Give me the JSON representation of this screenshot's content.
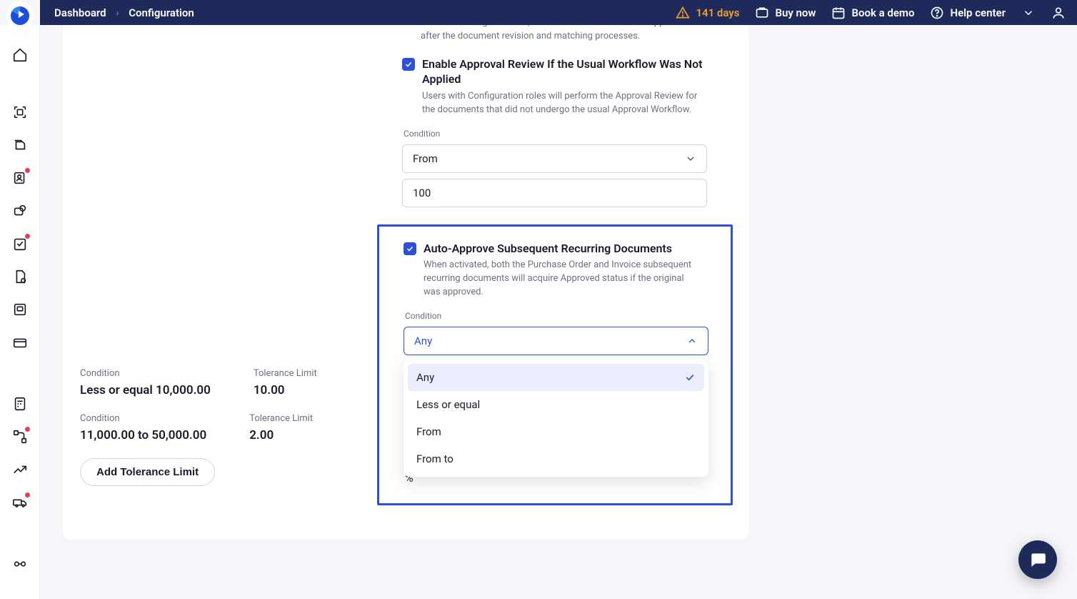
{
  "header": {
    "breadcrumb": [
      "Dashboard",
      "Configuration"
    ],
    "days_label": "141 days",
    "buy": "Buy now",
    "demo": "Book a demo",
    "help": "Help center"
  },
  "tolerance": {
    "rows": [
      {
        "cond_label": "Condition",
        "cond_value": "Less or equal 10,000.00",
        "tl_label": "Tolerance Limit",
        "tl_value": "10.00"
      },
      {
        "cond_label": "Condition",
        "cond_value": "11,000.00 to 50,000.00",
        "tl_label": "Tolerance Limit",
        "tl_value": "2.00"
      }
    ],
    "add_btn": "Add Tolerance Limit"
  },
  "settings": {
    "top_desc": "With this setting activated, the set TL will affect both re-approval after the document revision and matching processes.",
    "s1": {
      "title": "Enable Approval Review If the Usual Workflow Was Not Applied",
      "desc": "Users with Configuration roles will perform the Approval Review for the documents that did not undergo the usual Approval Workflow.",
      "cond_label": "Condition",
      "select_value": "From",
      "input_value": "100"
    },
    "s2": {
      "title": "Auto-Approve Subsequent Recurring Documents",
      "desc": "When activated, both the Purchase Order and Invoice subsequent recurring documents will acquire Approved status if the original was approved.",
      "cond_label": "Condition",
      "select_value": "Any",
      "options": [
        "Any",
        "Less or equal",
        "From",
        "From to"
      ],
      "percent": "%"
    }
  }
}
